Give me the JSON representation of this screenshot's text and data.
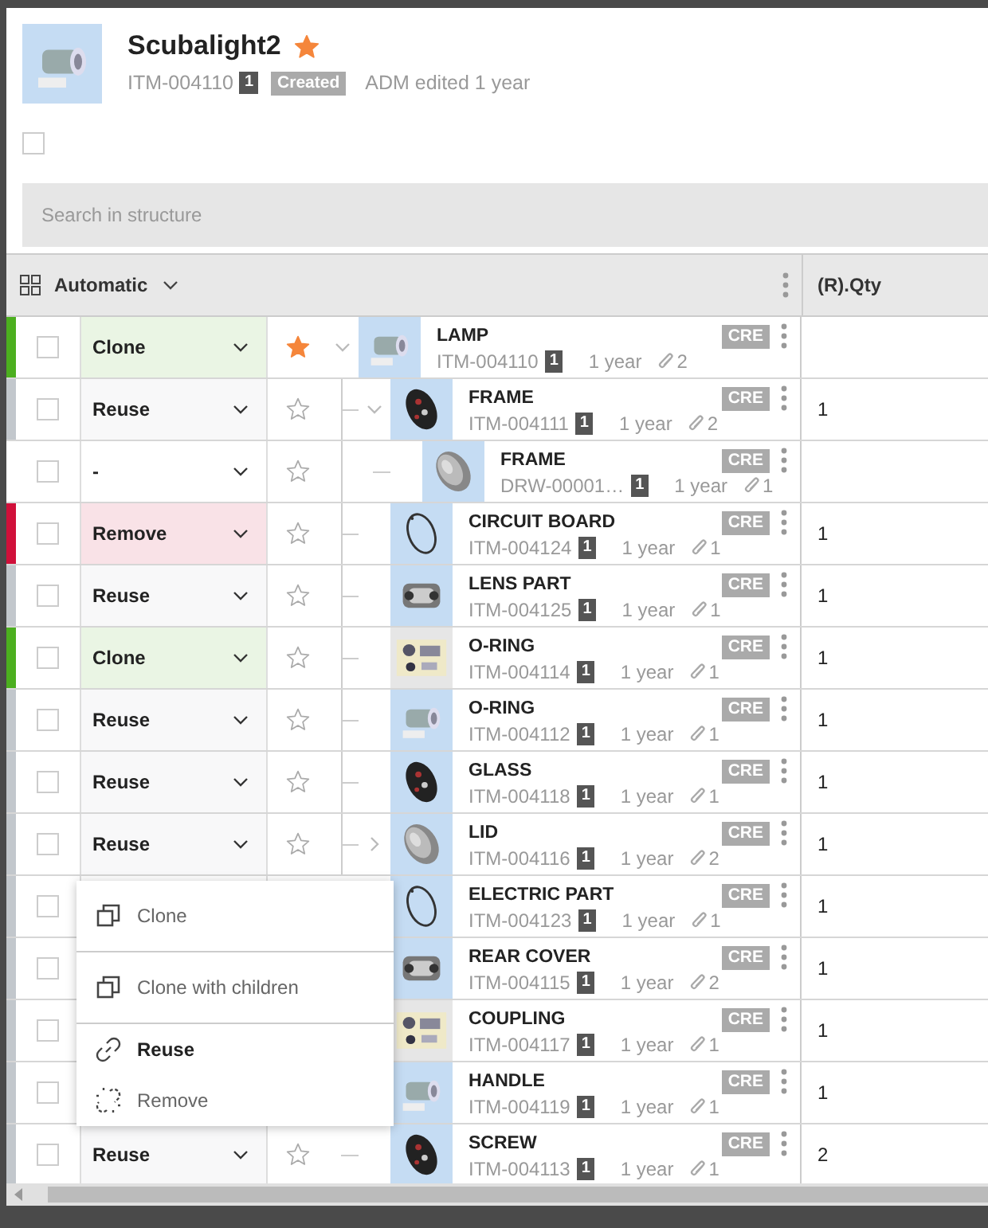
{
  "header": {
    "title": "Scubalight2",
    "starred": true,
    "number": "ITM-004110",
    "revision": "1",
    "state": "Created",
    "edited": "ADM edited 1 year",
    "select_all": {
      "checked": false
    }
  },
  "search": {
    "placeholder": "Search in structure"
  },
  "toolbar": {
    "view": "Automatic",
    "qty_column": "(R).Qty"
  },
  "rows": [
    {
      "name": "LAMP",
      "number": "ITM-004110",
      "revision": "1",
      "time": "1 year",
      "attachments": "2",
      "status": "CRE",
      "color": "#4caf1f",
      "checked": false,
      "action": {
        "label": "Clone"
      },
      "starred": true,
      "expanded": true,
      "children": [
        {
          "name": "FRAME",
          "number": "ITM-004111",
          "revision": "1",
          "time": "1 year",
          "attachments": "2",
          "status": "CRE",
          "qty": "1",
          "color": "#c2c7cc",
          "checked": false,
          "action": {
            "label": "Reuse"
          },
          "starred": false,
          "expanded": true,
          "children": [
            {
              "name": "FRAME",
              "number": "DRW-00001…",
              "revision": "1",
              "time": "1 year",
              "attachments": "1",
              "status": "CRE",
              "checked": false,
              "action": {
                "label": "-"
              },
              "starred": false
            }
          ]
        },
        {
          "name": "CIRCUIT BOARD",
          "number": "ITM-004124",
          "revision": "1",
          "time": "1 year",
          "attachments": "1",
          "status": "CRE",
          "qty": "1",
          "color": "#d0103a",
          "checked": false,
          "action": {
            "label": "Remove"
          },
          "starred": false
        },
        {
          "name": "LENS PART",
          "number": "ITM-004125",
          "revision": "1",
          "time": "1 year",
          "attachments": "1",
          "status": "CRE",
          "qty": "1",
          "color": "#c2c7cc",
          "checked": false,
          "action": {
            "label": "Reuse"
          },
          "starred": false
        },
        {
          "name": "O-RING",
          "number": "ITM-004114",
          "revision": "1",
          "time": "1 year",
          "attachments": "1",
          "status": "CRE",
          "qty": "1",
          "color": "#4caf1f",
          "checked": false,
          "action": {
            "label": "Clone"
          },
          "starred": false
        },
        {
          "name": "O-RING",
          "number": "ITM-004112",
          "revision": "1",
          "time": "1 year",
          "attachments": "1",
          "status": "CRE",
          "qty": "1",
          "color": "#c2c7cc",
          "checked": false,
          "action": {
            "label": "Reuse"
          },
          "starred": false
        },
        {
          "name": "GLASS",
          "number": "ITM-004118",
          "revision": "1",
          "time": "1 year",
          "attachments": "1",
          "status": "CRE",
          "qty": "1",
          "color": "#c2c7cc",
          "checked": false,
          "action": {
            "label": "Reuse"
          },
          "starred": false
        },
        {
          "name": "LID",
          "number": "ITM-004116",
          "revision": "1",
          "time": "1 year",
          "attachments": "2",
          "status": "CRE",
          "qty": "1",
          "color": "#c2c7cc",
          "checked": false,
          "action": {
            "label": "Reuse"
          },
          "starred": false,
          "expanded": false
        },
        {
          "name": "ELECTRIC PART",
          "number": "ITM-004123",
          "revision": "1",
          "time": "1 year",
          "attachments": "1",
          "status": "CRE",
          "qty": "1",
          "color": "#c2c7cc",
          "checked": false
        },
        {
          "name": "REAR COVER",
          "number": "ITM-004115",
          "revision": "1",
          "time": "1 year",
          "attachments": "2",
          "status": "CRE",
          "qty": "1",
          "color": "#c2c7cc",
          "checked": false
        },
        {
          "name": "COUPLING",
          "number": "ITM-004117",
          "revision": "1",
          "time": "1 year",
          "attachments": "1",
          "status": "CRE",
          "qty": "1",
          "color": "#c2c7cc",
          "checked": false
        },
        {
          "name": "HANDLE",
          "number": "ITM-004119",
          "revision": "1",
          "time": "1 year",
          "attachments": "1",
          "status": "CRE",
          "qty": "1",
          "color": "#c2c7cc",
          "checked": false
        },
        {
          "name": "SCREW",
          "number": "ITM-004113",
          "revision": "1",
          "time": "1 year",
          "attachments": "1",
          "status": "CRE",
          "qty": "2",
          "color": "#c2c7cc",
          "checked": false,
          "action": {
            "label": "Reuse"
          },
          "starred": false
        }
      ]
    }
  ],
  "menu": {
    "groups": [
      {
        "items": [
          {
            "label": "Clone",
            "kind": "copy",
            "selected": false
          }
        ]
      },
      {
        "items": [
          {
            "label": "Clone with children",
            "kind": "copy",
            "selected": false
          }
        ]
      },
      {
        "items": [
          {
            "label": "Reuse",
            "kind": "link",
            "selected": true
          },
          {
            "label": "Remove",
            "kind": "unlink",
            "selected": false
          }
        ]
      }
    ]
  }
}
